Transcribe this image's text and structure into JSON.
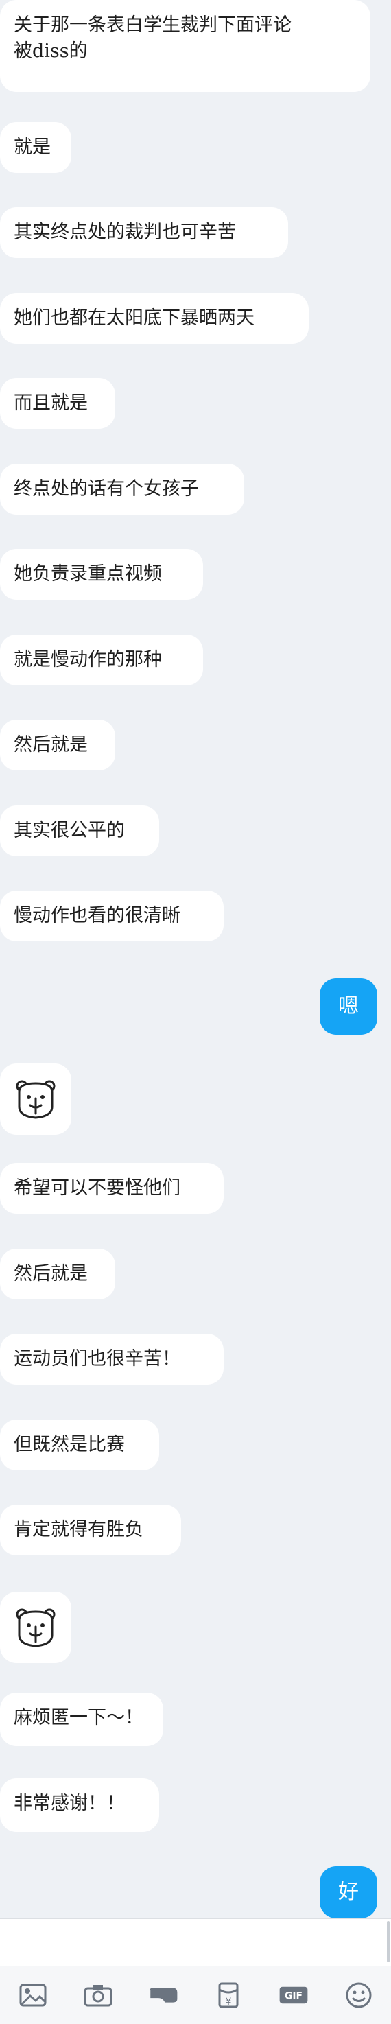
{
  "messages": [
    {
      "side": "left",
      "text": "关于那一条表白学生裁判下面评论\n被diss的"
    },
    {
      "side": "left",
      "text": "就是"
    },
    {
      "side": "left",
      "text": "其实终点处的裁判也可辛苦"
    },
    {
      "side": "left",
      "text": "她们也都在太阳底下暴晒两天"
    },
    {
      "side": "left",
      "text": "而且就是"
    },
    {
      "side": "left",
      "text": "终点处的话有个女孩子"
    },
    {
      "side": "left",
      "text": "她负责录重点视频"
    },
    {
      "side": "left",
      "text": "就是慢动作的那种"
    },
    {
      "side": "left",
      "text": "然后就是"
    },
    {
      "side": "left",
      "text": "其实很公平的"
    },
    {
      "side": "left",
      "text": "慢动作也看的很清晰"
    },
    {
      "side": "right",
      "text": "嗯"
    },
    {
      "side": "left",
      "sticker": "bear-sticker"
    },
    {
      "side": "left",
      "text": "希望可以不要怪他们"
    },
    {
      "side": "left",
      "text": "然后就是"
    },
    {
      "side": "left",
      "text": "运动员们也很辛苦！"
    },
    {
      "side": "left",
      "text": "但既然是比赛"
    },
    {
      "side": "left",
      "text": "肯定就得有胜负"
    },
    {
      "side": "left",
      "sticker": "bear-sticker"
    },
    {
      "side": "left",
      "text": "麻烦匿一下～！"
    },
    {
      "side": "left",
      "text": "非常感谢！！"
    },
    {
      "side": "right",
      "text": "好"
    }
  ],
  "toolbar": {
    "icons": [
      "image-icon",
      "camera-icon",
      "hongbao-icon",
      "red-packet-icon",
      "gif-icon",
      "emoji-icon"
    ],
    "gif_label": "GIF",
    "yen_label": "¥"
  },
  "colors": {
    "bubble_out": "#15a4f5",
    "bubble_in": "#ffffff",
    "bg": "#eef1f5"
  }
}
